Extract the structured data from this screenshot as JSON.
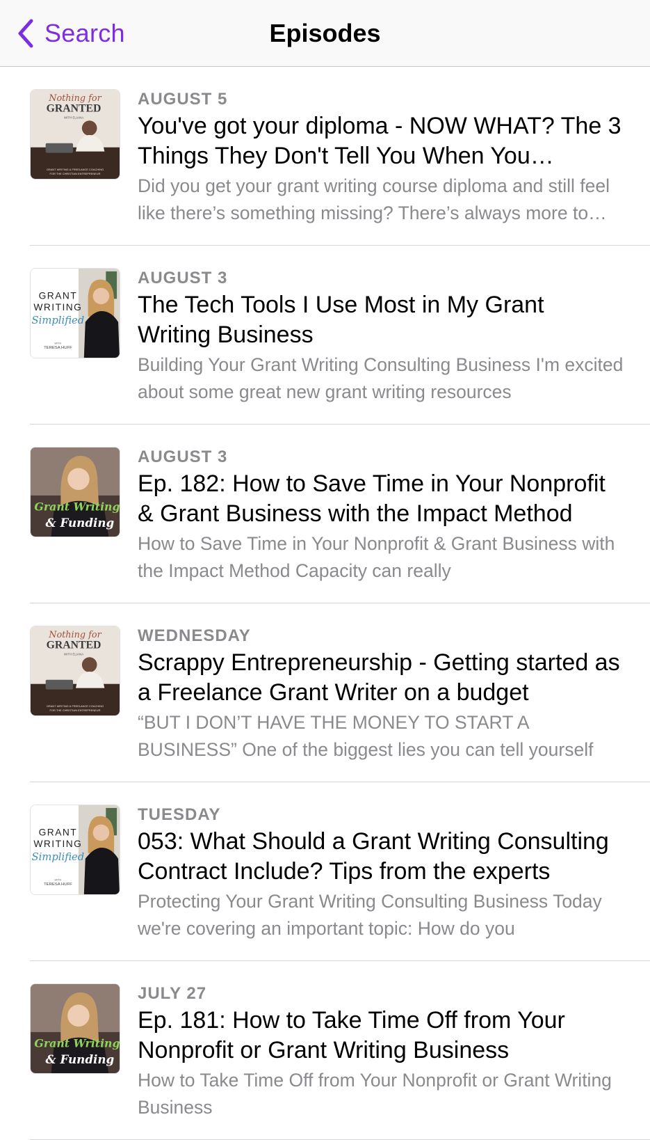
{
  "nav": {
    "back_label": "Search",
    "title": "Episodes",
    "accent_color": "#7c2ee0"
  },
  "episodes": [
    {
      "art": "nothing-for-granted",
      "date": "AUGUST 5",
      "title": "You've got your diploma - NOW WHAT? The 3 Things They Don't Tell You When You Graduate",
      "description": "Did you get your grant writing course diploma and still feel like there’s something missing? There’s always more to learn"
    },
    {
      "art": "grant-writing-simplified",
      "date": "AUGUST 3",
      "title": "The Tech Tools I Use Most in My Grant Writing Business",
      "description": "Building Your Grant Writing Consulting Business I'm excited about some great new grant writing resources"
    },
    {
      "art": "grant-writing-funding",
      "date": "AUGUST 3",
      "title": "Ep. 182: How to Save Time in Your Nonprofit & Grant Business with the Impact Method",
      "description": "How to Save Time in Your Nonprofit & Grant Business with the Impact Method Capacity can really"
    },
    {
      "art": "nothing-for-granted",
      "date": "WEDNESDAY",
      "title": "Scrappy Entrepreneurship - Getting started as a Freelance Grant Writer on a budget",
      "description": "“BUT I DON’T HAVE THE MONEY TO START A BUSINESS” One of the biggest lies you can tell yourself"
    },
    {
      "art": "grant-writing-simplified",
      "date": "TUESDAY",
      "title": "053: What Should a Grant Writing Consulting Contract Include? Tips from the experts",
      "description": "Protecting Your Grant Writing Consulting Business Today we're covering an important topic: How do you"
    },
    {
      "art": "grant-writing-funding",
      "date": "JULY 27",
      "title": "Ep. 181: How to Take Time Off  from Your Nonprofit or Grant Writing Business",
      "description": "How to Take Time Off from Your Nonprofit or Grant Writing Business"
    }
  ],
  "artwork": {
    "nothing-for-granted": {
      "script": "Nothing for",
      "title": "GRANTED",
      "subtitle": "WITH ELIANA",
      "footer1": "GRANT WRITING & FREELANCE COACHING",
      "footer2": "FOR THE CHRISTIAN ENTREPRENEUR"
    },
    "grant-writing-simplified": {
      "line1": "GRANT",
      "line2": "WRITING",
      "script": "Simplified",
      "with": "WITH",
      "host": "TERESA HUFF"
    },
    "grant-writing-funding": {
      "line1": "Grant Writing",
      "line2": "& Funding"
    }
  }
}
